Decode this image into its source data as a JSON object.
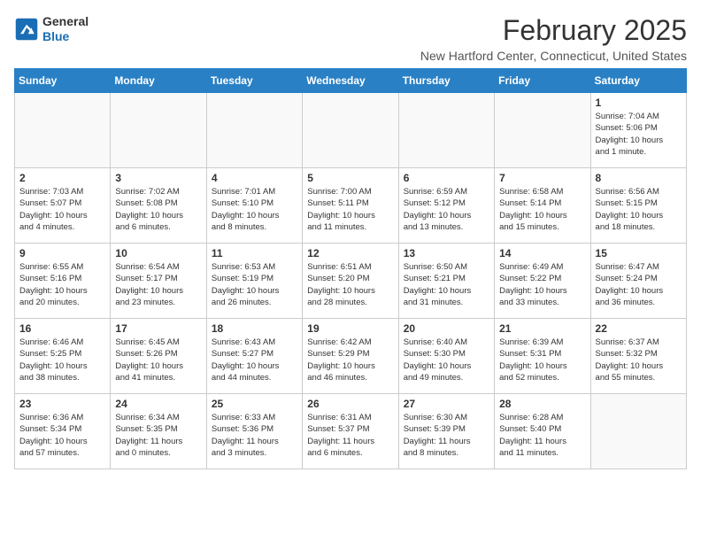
{
  "header": {
    "logo_line1": "General",
    "logo_line2": "Blue",
    "month_year": "February 2025",
    "location": "New Hartford Center, Connecticut, United States"
  },
  "weekdays": [
    "Sunday",
    "Monday",
    "Tuesday",
    "Wednesday",
    "Thursday",
    "Friday",
    "Saturday"
  ],
  "weeks": [
    [
      {
        "day": "",
        "info": ""
      },
      {
        "day": "",
        "info": ""
      },
      {
        "day": "",
        "info": ""
      },
      {
        "day": "",
        "info": ""
      },
      {
        "day": "",
        "info": ""
      },
      {
        "day": "",
        "info": ""
      },
      {
        "day": "1",
        "info": "Sunrise: 7:04 AM\nSunset: 5:06 PM\nDaylight: 10 hours\nand 1 minute."
      }
    ],
    [
      {
        "day": "2",
        "info": "Sunrise: 7:03 AM\nSunset: 5:07 PM\nDaylight: 10 hours\nand 4 minutes."
      },
      {
        "day": "3",
        "info": "Sunrise: 7:02 AM\nSunset: 5:08 PM\nDaylight: 10 hours\nand 6 minutes."
      },
      {
        "day": "4",
        "info": "Sunrise: 7:01 AM\nSunset: 5:10 PM\nDaylight: 10 hours\nand 8 minutes."
      },
      {
        "day": "5",
        "info": "Sunrise: 7:00 AM\nSunset: 5:11 PM\nDaylight: 10 hours\nand 11 minutes."
      },
      {
        "day": "6",
        "info": "Sunrise: 6:59 AM\nSunset: 5:12 PM\nDaylight: 10 hours\nand 13 minutes."
      },
      {
        "day": "7",
        "info": "Sunrise: 6:58 AM\nSunset: 5:14 PM\nDaylight: 10 hours\nand 15 minutes."
      },
      {
        "day": "8",
        "info": "Sunrise: 6:56 AM\nSunset: 5:15 PM\nDaylight: 10 hours\nand 18 minutes."
      }
    ],
    [
      {
        "day": "9",
        "info": "Sunrise: 6:55 AM\nSunset: 5:16 PM\nDaylight: 10 hours\nand 20 minutes."
      },
      {
        "day": "10",
        "info": "Sunrise: 6:54 AM\nSunset: 5:17 PM\nDaylight: 10 hours\nand 23 minutes."
      },
      {
        "day": "11",
        "info": "Sunrise: 6:53 AM\nSunset: 5:19 PM\nDaylight: 10 hours\nand 26 minutes."
      },
      {
        "day": "12",
        "info": "Sunrise: 6:51 AM\nSunset: 5:20 PM\nDaylight: 10 hours\nand 28 minutes."
      },
      {
        "day": "13",
        "info": "Sunrise: 6:50 AM\nSunset: 5:21 PM\nDaylight: 10 hours\nand 31 minutes."
      },
      {
        "day": "14",
        "info": "Sunrise: 6:49 AM\nSunset: 5:22 PM\nDaylight: 10 hours\nand 33 minutes."
      },
      {
        "day": "15",
        "info": "Sunrise: 6:47 AM\nSunset: 5:24 PM\nDaylight: 10 hours\nand 36 minutes."
      }
    ],
    [
      {
        "day": "16",
        "info": "Sunrise: 6:46 AM\nSunset: 5:25 PM\nDaylight: 10 hours\nand 38 minutes."
      },
      {
        "day": "17",
        "info": "Sunrise: 6:45 AM\nSunset: 5:26 PM\nDaylight: 10 hours\nand 41 minutes."
      },
      {
        "day": "18",
        "info": "Sunrise: 6:43 AM\nSunset: 5:27 PM\nDaylight: 10 hours\nand 44 minutes."
      },
      {
        "day": "19",
        "info": "Sunrise: 6:42 AM\nSunset: 5:29 PM\nDaylight: 10 hours\nand 46 minutes."
      },
      {
        "day": "20",
        "info": "Sunrise: 6:40 AM\nSunset: 5:30 PM\nDaylight: 10 hours\nand 49 minutes."
      },
      {
        "day": "21",
        "info": "Sunrise: 6:39 AM\nSunset: 5:31 PM\nDaylight: 10 hours\nand 52 minutes."
      },
      {
        "day": "22",
        "info": "Sunrise: 6:37 AM\nSunset: 5:32 PM\nDaylight: 10 hours\nand 55 minutes."
      }
    ],
    [
      {
        "day": "23",
        "info": "Sunrise: 6:36 AM\nSunset: 5:34 PM\nDaylight: 10 hours\nand 57 minutes."
      },
      {
        "day": "24",
        "info": "Sunrise: 6:34 AM\nSunset: 5:35 PM\nDaylight: 11 hours\nand 0 minutes."
      },
      {
        "day": "25",
        "info": "Sunrise: 6:33 AM\nSunset: 5:36 PM\nDaylight: 11 hours\nand 3 minutes."
      },
      {
        "day": "26",
        "info": "Sunrise: 6:31 AM\nSunset: 5:37 PM\nDaylight: 11 hours\nand 6 minutes."
      },
      {
        "day": "27",
        "info": "Sunrise: 6:30 AM\nSunset: 5:39 PM\nDaylight: 11 hours\nand 8 minutes."
      },
      {
        "day": "28",
        "info": "Sunrise: 6:28 AM\nSunset: 5:40 PM\nDaylight: 11 hours\nand 11 minutes."
      },
      {
        "day": "",
        "info": ""
      }
    ]
  ]
}
